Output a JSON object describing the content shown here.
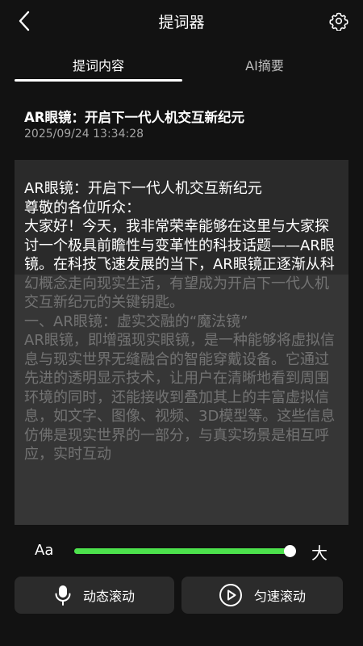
{
  "header": {
    "title": "提词器",
    "back_icon": "chevron-left-icon",
    "settings_icon": "gear-icon"
  },
  "tabs": [
    {
      "label": "提词内容",
      "active": true
    },
    {
      "label": "AI摘要",
      "active": false
    }
  ],
  "document": {
    "title": "AR眼镜：开启下一代人机交互新纪元",
    "timestamp": "2025/09/24 13:34:28",
    "body": "AR眼镜：开启下一代人机交互新纪元\n尊敬的各位听众：\n大家好！今天，我非常荣幸能够在这里与大家探讨一个极具前瞻性与变革性的科技话题——AR眼镜。在科技飞速发展的当下，AR眼镜正逐渐从科幻概念走向现实生活，有望成为开启下一代人机交互新纪元的关键钥匙。\n一、AR眼镜：虚实交融的“魔法镜”\nAR眼镜，即增强现实眼镜，是一种能够将虚拟信息与现实世界无缝融合的智能穿戴设备。它通过先进的透明显示技术，让用户在清晰地看到周围环境的同时，还能接收到叠加其上的丰富虚拟信息，如文字、图像、视频、3D模型等。这些信息仿佛是现实世界的一部分，与真实场景是相互呼应，实时互动"
  },
  "font_size": {
    "small_label": "Aa",
    "large_label": "大",
    "value_fraction": 0.99,
    "accent_color": "#4de24d"
  },
  "buttons": {
    "dynamic_scroll": {
      "label": "动态滚动",
      "icon": "microphone-icon"
    },
    "uniform_scroll": {
      "label": "匀速滚动",
      "icon": "play-circle-icon"
    }
  }
}
